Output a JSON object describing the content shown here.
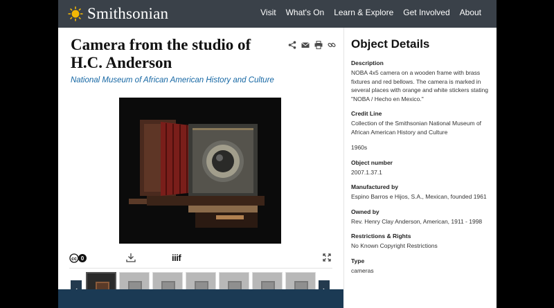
{
  "header": {
    "logo_text": "Smithsonian",
    "nav": [
      "Visit",
      "What's On",
      "Learn & Explore",
      "Get Involved",
      "About"
    ]
  },
  "object": {
    "title_line1": "Camera from the studio of",
    "title_line2": "H.C. Anderson",
    "museum": "National Museum of African American History and Culture"
  },
  "toolbar": {
    "iiif_label": "iiif",
    "license_icon": "cc0-icon",
    "download_icon": "download-icon",
    "expand_icon": "expand-icon"
  },
  "thumbnails": {
    "count": 7,
    "active_index": 0,
    "prev_label": "‹",
    "next_label": "›"
  },
  "details": {
    "heading": "Object Details",
    "description_label": "Description",
    "description": "NOBA 4x5 camera on a wooden frame with brass fixtures and red bellows. The camera is marked in several places with orange and white stickers stating \"NOBA / Hecho en Mexico.\"",
    "credit_label": "Credit Line",
    "credit": "Collection of the Smithsonian National Museum of African American History and Culture",
    "date": "1960s",
    "object_number_label": "Object number",
    "object_number": "2007.1.37.1",
    "manufactured_label": "Manufactured by",
    "manufactured": "Espino Barros e Hijos, S.A., Mexican, founded 1961",
    "owned_label": "Owned by",
    "owned": "Rev. Henry Clay Anderson, American, 1911 - 1998",
    "restrictions_label": "Restrictions & Rights",
    "restrictions": "No Known Copyright Restrictions",
    "type_label": "Type",
    "type": "cameras"
  },
  "colors": {
    "header_bg": "#3a4149",
    "link_blue": "#1466a3",
    "sun_yellow": "#f2b705",
    "nav_dark": "#243a4e"
  }
}
